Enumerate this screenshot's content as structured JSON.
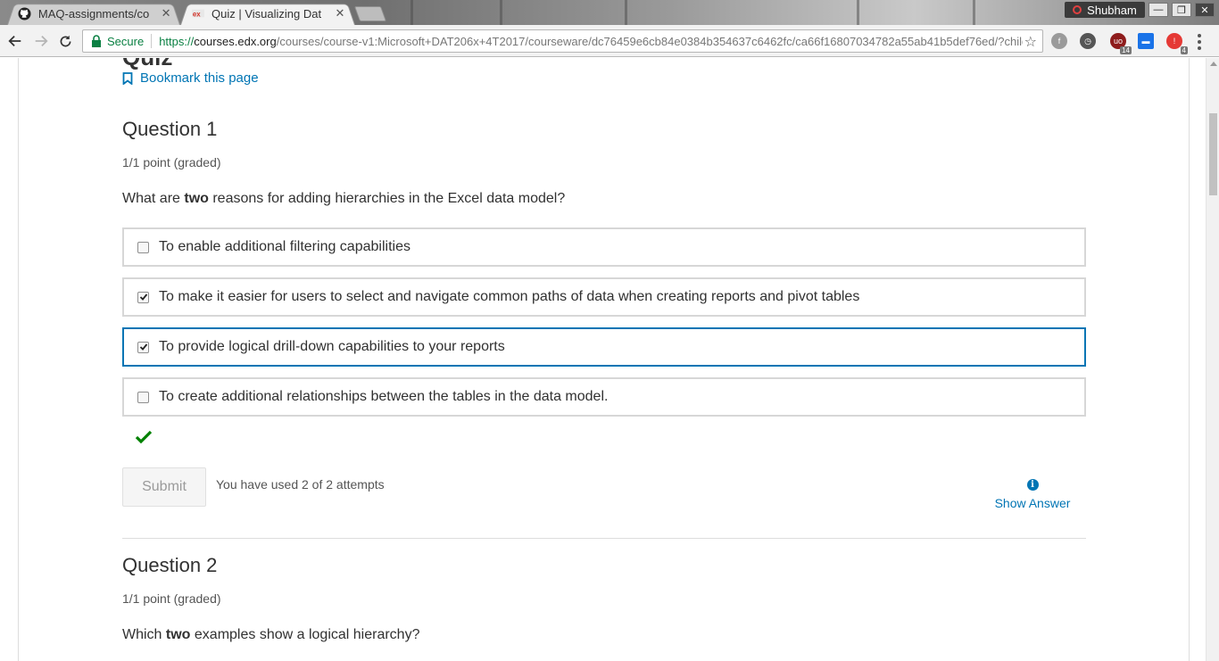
{
  "browser": {
    "tabs": [
      {
        "title": "MAQ-assignments/co",
        "icon": "github-icon",
        "active": false
      },
      {
        "title": "Quiz | Visualizing Dat",
        "icon": "edx-icon",
        "active": true
      }
    ],
    "profile_name": "Shubham",
    "secure_label": "Secure",
    "url_proto": "https://",
    "url_host": "courses.edx.org",
    "url_path": "/courses/course-v1:Microsoft+DAT206x+4T2017/courseware/dc76459e6cb84e0384b354637c6462fc/ca66f16807034782a55ab41b5def76ed/?child...",
    "extensions": [
      {
        "name": "feedly-icon",
        "badge": ""
      },
      {
        "name": "speed-dial-icon",
        "badge": ""
      },
      {
        "name": "ublock-icon",
        "badge": "14"
      },
      {
        "name": "cast-icon",
        "badge": ""
      },
      {
        "name": "alert-icon",
        "badge": "4"
      }
    ]
  },
  "page": {
    "heading_cut": "Quiz",
    "bookmark_label": "Bookmark this page",
    "question1": {
      "title": "Question 1",
      "meta": "1/1 point (graded)",
      "prompt_pre": "What are ",
      "prompt_bold": "two",
      "prompt_post": " reasons for adding hierarchies in the Excel data model?",
      "options": [
        {
          "label": "To enable additional filtering capabilities",
          "checked": false
        },
        {
          "label": "To make it easier for users to select and navigate common paths of data when creating reports and pivot tables",
          "checked": true
        },
        {
          "label": "To provide logical drill-down capabilities to your reports",
          "checked": true
        },
        {
          "label": "To create additional relationships between the tables in the data model.",
          "checked": false
        }
      ],
      "status": "correct",
      "submit_label": "Submit",
      "attempts_text": "You have used 2 of 2 attempts",
      "show_answer_label": "Show Answer"
    },
    "question2": {
      "title": "Question 2",
      "meta": "1/1 point (graded)",
      "prompt_pre": "Which ",
      "prompt_bold": "two",
      "prompt_post": " examples show a logical hierarchy?"
    }
  },
  "colors": {
    "link": "#0075b4",
    "correct": "#008100",
    "secure": "#0b8043",
    "focus_border": "#0075b4"
  }
}
